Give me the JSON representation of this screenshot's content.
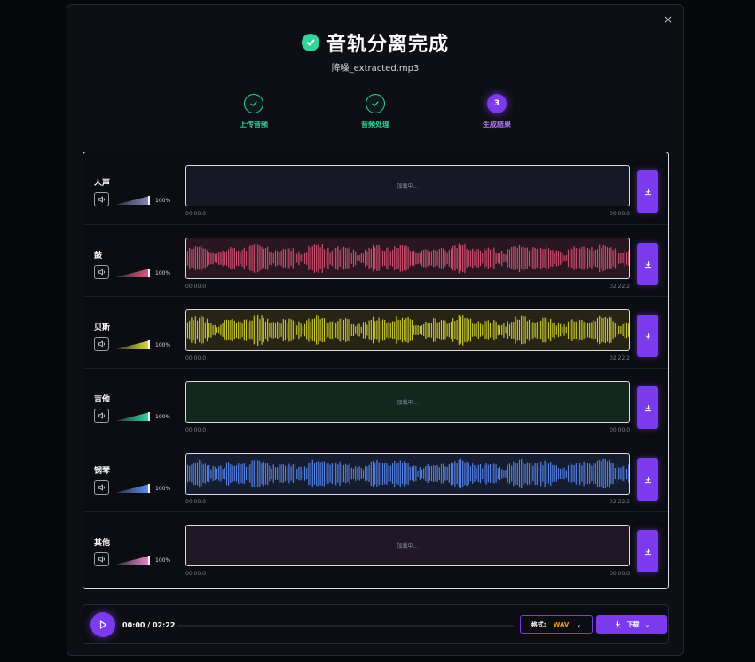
{
  "modal": {
    "title": "音轨分离完成",
    "subtitle": "降噪_extracted.mp3",
    "close_icon": "×"
  },
  "steps": [
    {
      "label": "上传音频",
      "state": "done",
      "mark": "check"
    },
    {
      "label": "音频处理",
      "state": "done",
      "mark": "check"
    },
    {
      "label": "生成结果",
      "state": "active",
      "mark": "3"
    }
  ],
  "tracks": [
    {
      "name": "人声",
      "volume": "100%",
      "color": "#7f88b8",
      "wave_bg": "#161925",
      "status": "loading",
      "loading_text": "加载中...",
      "start": "00:00.0",
      "end": "00:00.0"
    },
    {
      "name": "鼓",
      "volume": "100%",
      "color": "#e0557a",
      "wave_bg": "#2a1620",
      "status": "ready",
      "loading_text": "",
      "start": "00:00.0",
      "end": "02:22.2"
    },
    {
      "name": "贝斯",
      "volume": "100%",
      "color": "#d8d836",
      "wave_bg": "#262414",
      "status": "ready",
      "loading_text": "",
      "start": "00:00.0",
      "end": "02:22.2"
    },
    {
      "name": "吉他",
      "volume": "100%",
      "color": "#34d399",
      "wave_bg": "#12281f",
      "status": "loading",
      "loading_text": "加载中...",
      "start": "00:00.0",
      "end": "00:00.0"
    },
    {
      "name": "钢琴",
      "volume": "100%",
      "color": "#5b8cf5",
      "wave_bg": "#151c30",
      "status": "ready",
      "loading_text": "",
      "start": "00:00.0",
      "end": "02:22.2"
    },
    {
      "name": "其他",
      "volume": "100%",
      "color": "#e884c6",
      "wave_bg": "#221825",
      "status": "loading",
      "loading_text": "加载中...",
      "start": "00:00.0",
      "end": "00:00.0"
    }
  ],
  "player": {
    "time": "00:00 / 02:22",
    "progress": 0,
    "format_label": "格式:",
    "format_value": "WAV",
    "download_label": "下载"
  },
  "colors": {
    "accent": "#7c3aed",
    "success": "#34d399",
    "format_highlight": "#f59e0b"
  }
}
